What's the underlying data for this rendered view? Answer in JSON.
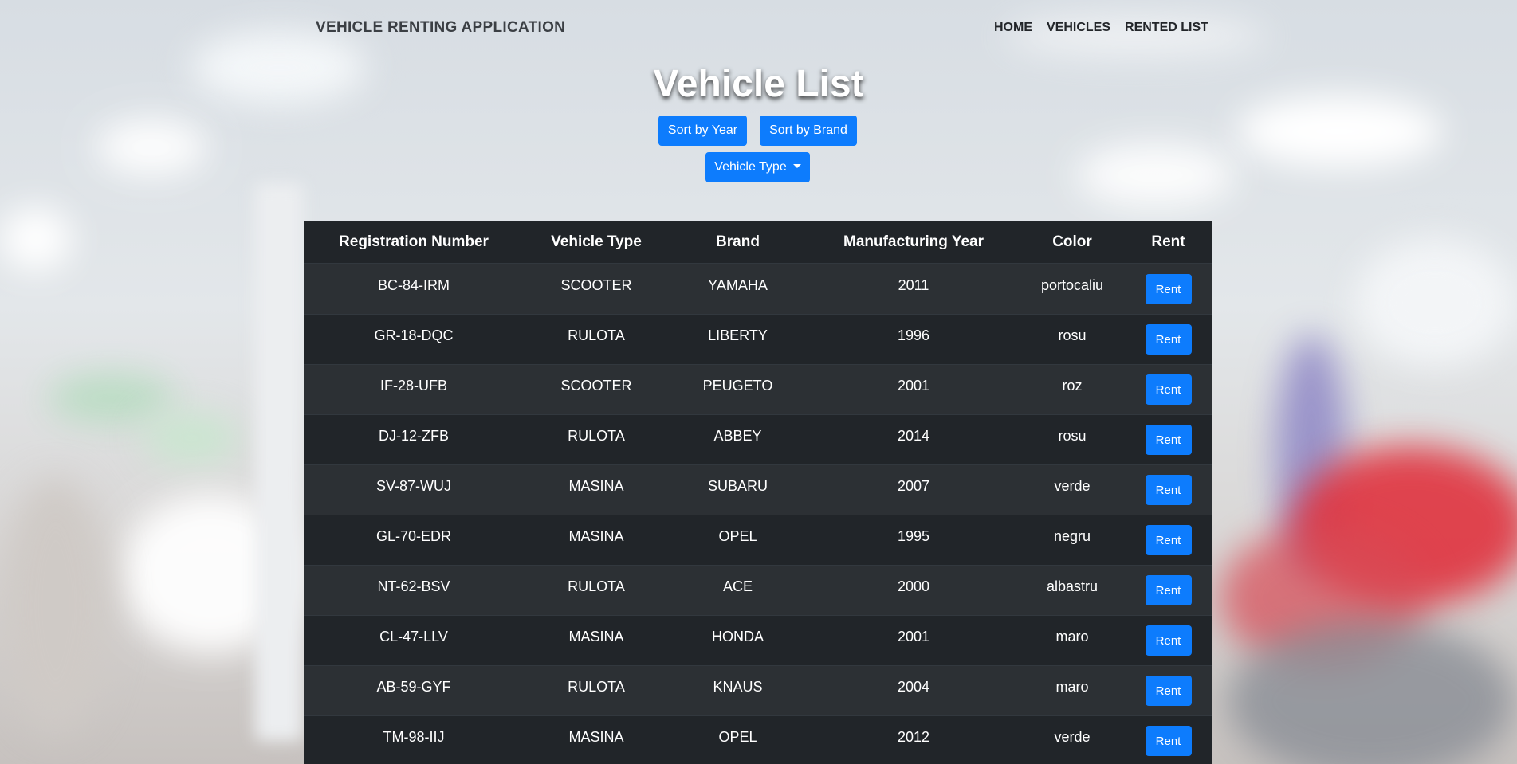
{
  "navbar": {
    "brand": "VEHICLE RENTING APPLICATION",
    "links": [
      "HOME",
      "VEHICLES",
      "RENTED LIST"
    ]
  },
  "page": {
    "title": "Vehicle List",
    "sort_year_label": "Sort by Year",
    "sort_brand_label": "Sort by Brand",
    "vehicle_type_label": "Vehicle Type"
  },
  "table": {
    "headers": [
      "Registration Number",
      "Vehicle Type",
      "Brand",
      "Manufacturing Year",
      "Color",
      "Rent"
    ],
    "rent_label": "Rent",
    "rows": [
      [
        "BC-84-IRM",
        "SCOOTER",
        "YAMAHA",
        "2011",
        "portocaliu"
      ],
      [
        "GR-18-DQC",
        "RULOTA",
        "LIBERTY",
        "1996",
        "rosu"
      ],
      [
        "IF-28-UFB",
        "SCOOTER",
        "PEUGETO",
        "2001",
        "roz"
      ],
      [
        "DJ-12-ZFB",
        "RULOTA",
        "ABBEY",
        "2014",
        "rosu"
      ],
      [
        "SV-87-WUJ",
        "MASINA",
        "SUBARU",
        "2007",
        "verde"
      ],
      [
        "GL-70-EDR",
        "MASINA",
        "OPEL",
        "1995",
        "negru"
      ],
      [
        "NT-62-BSV",
        "RULOTA",
        "ACE",
        "2000",
        "albastru"
      ],
      [
        "CL-47-LLV",
        "MASINA",
        "HONDA",
        "2001",
        "maro"
      ],
      [
        "AB-59-GYF",
        "RULOTA",
        "KNAUS",
        "2004",
        "maro"
      ],
      [
        "TM-98-IIJ",
        "MASINA",
        "OPEL",
        "2012",
        "verde"
      ]
    ]
  },
  "colors": {
    "primary_button": "#0d7cfd",
    "table_dark": "#212529",
    "table_stripe": "#2c3034"
  }
}
